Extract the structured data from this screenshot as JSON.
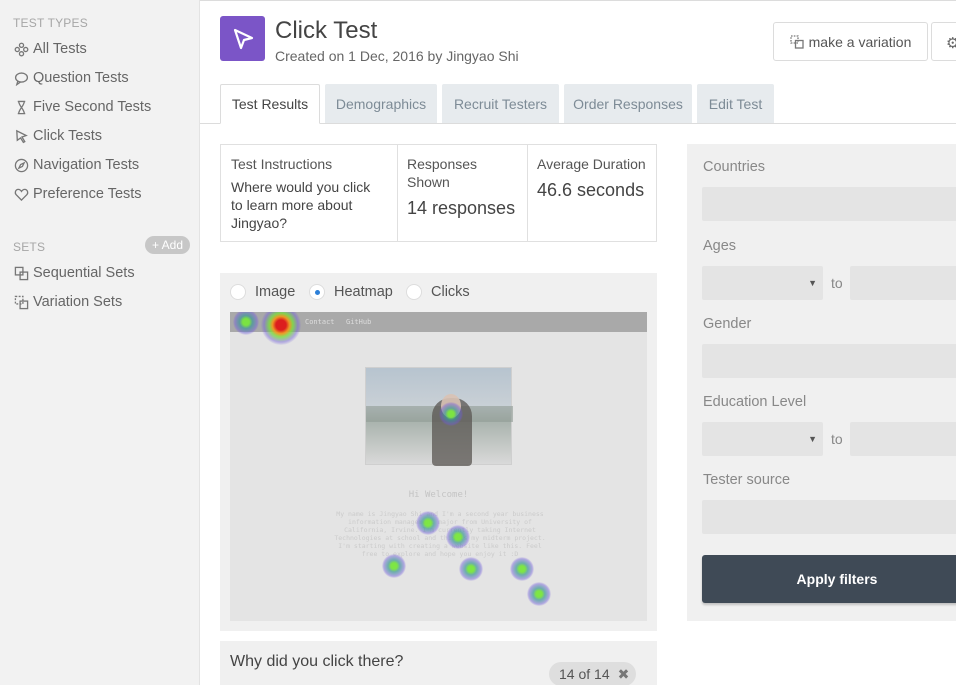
{
  "sidebar": {
    "test_types_heading": "TEST TYPES",
    "items": [
      {
        "label": "All Tests",
        "icon": "all-tests-icon"
      },
      {
        "label": "Question Tests",
        "icon": "question-icon"
      },
      {
        "label": "Five Second Tests",
        "icon": "hourglass-icon"
      },
      {
        "label": "Click Tests",
        "icon": "cursor-icon"
      },
      {
        "label": "Navigation Tests",
        "icon": "compass-icon"
      },
      {
        "label": "Preference Tests",
        "icon": "heart-icon"
      }
    ],
    "sets_heading": "SETS",
    "add_label": "+ Add",
    "sets": [
      {
        "label": "Sequential Sets",
        "icon": "sets-icon"
      },
      {
        "label": "Variation Sets",
        "icon": "variation-icon"
      }
    ]
  },
  "header": {
    "title": "Click Test",
    "subtitle": "Created on 1 Dec, 2016 by Jingyao Shi",
    "variation_label": "make a variation",
    "logo_color": "#7b55c7"
  },
  "tabs": [
    {
      "label": "Test Results",
      "active": true
    },
    {
      "label": "Demographics",
      "active": false
    },
    {
      "label": "Recruit Testers",
      "active": false
    },
    {
      "label": "Order Responses",
      "active": false
    },
    {
      "label": "Edit Test",
      "active": false
    }
  ],
  "info": {
    "instructions_label": "Test Instructions",
    "instructions_text": "Where would you click to learn more about Jingyao?",
    "responses_label": "Responses Shown",
    "responses_value": "14 responses",
    "duration_label": "Average Duration",
    "duration_value": "46.6 seconds"
  },
  "view_options": {
    "image": "Image",
    "heatmap": "Heatmap",
    "clicks": "Clicks",
    "selected": "Heatmap"
  },
  "preview": {
    "nav_links": [
      "Contact",
      "GitHub"
    ],
    "greeting": "Hi Welcome!",
    "paragraph": "My name is Jingyao Shi and I'm a second year business information management major from University of California, Irvine. I'm currently taking Internet Technologies at school and this is my midterm project. I'm starting with creating a website like this. Feel free to explore and hope you enjoy it :D"
  },
  "why": {
    "question": "Why did you click there?",
    "badge": "14 of 14"
  },
  "filters": {
    "countries_label": "Countries",
    "ages_label": "Ages",
    "gender_label": "Gender",
    "education_label": "Education Level",
    "tester_source_label": "Tester source",
    "to_label": "to",
    "apply_label": "Apply filters"
  }
}
